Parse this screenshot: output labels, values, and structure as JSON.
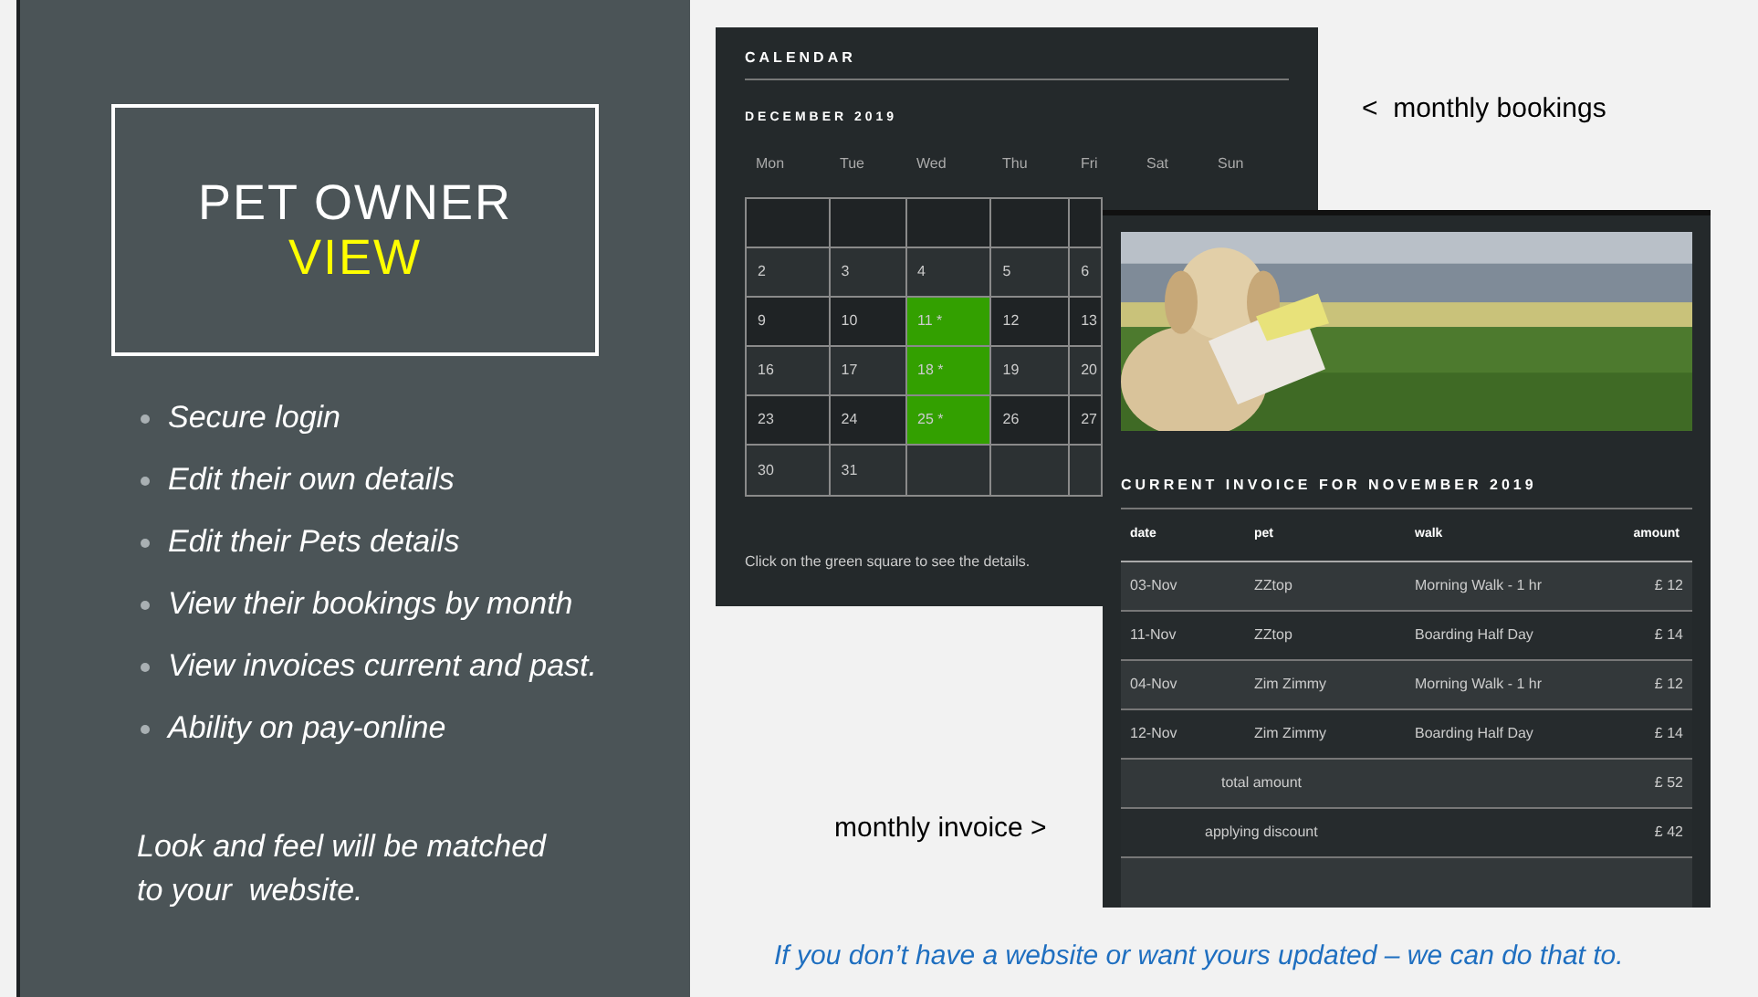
{
  "slide": {
    "title": "PET OWNER",
    "title_highlight": "VIEW",
    "bullets": [
      "Secure login",
      "Edit their own details",
      "Edit their Pets details",
      "View their bookings by month",
      "View invoices current and past.",
      "Ability on pay-online"
    ],
    "note": "Look and feel will be matched\nto your  website.",
    "bookings_caption": "<  monthly bookings",
    "invoice_caption": "monthly invoice >",
    "footer": "If you don’t have a website or want yours updated – we can do that to."
  },
  "calendar": {
    "title": "CALENDAR",
    "month": "DECEMBER 2019",
    "weekdays": [
      "Mon",
      "Tue",
      "Wed",
      "Thu",
      "Fri",
      "Sat",
      "Sun"
    ],
    "weeks": [
      [
        {
          "booked": false
        },
        {
          "booked": false
        },
        {
          "booked": false
        },
        {
          "booked": false
        },
        {
          "booked": false
        }
      ],
      [
        {
          "day": "2",
          "booked": false
        },
        {
          "day": "3",
          "booked": false
        },
        {
          "day": "4",
          "booked": false
        },
        {
          "day": "5",
          "booked": false
        },
        {
          "day": "6",
          "booked": false
        }
      ],
      [
        {
          "day": "9",
          "booked": false
        },
        {
          "day": "10",
          "booked": false
        },
        {
          "day": "11 *",
          "booked": true
        },
        {
          "day": "12",
          "booked": false
        },
        {
          "day": "13",
          "booked": false
        }
      ],
      [
        {
          "day": "16",
          "booked": false
        },
        {
          "day": "17",
          "booked": false
        },
        {
          "day": "18 *",
          "booked": true
        },
        {
          "day": "19",
          "booked": false
        },
        {
          "day": "20",
          "booked": false
        }
      ],
      [
        {
          "day": "23",
          "booked": false
        },
        {
          "day": "24",
          "booked": false
        },
        {
          "day": "25 *",
          "booked": true
        },
        {
          "day": "26",
          "booked": false
        },
        {
          "day": "27",
          "booked": false
        }
      ],
      [
        {
          "day": "30",
          "booked": false
        },
        {
          "day": "31",
          "booked": false
        },
        {
          "booked": false
        },
        {
          "booked": false
        },
        {
          "booked": false
        }
      ]
    ],
    "hint": "Click on the green square to see the details."
  },
  "invoice": {
    "picture": {
      "kind": "picture"
    },
    "title": "CURRENT INVOICE FOR NOVEMBER 2019",
    "columns": [
      "date",
      "pet",
      "walk",
      "amount"
    ],
    "rows": [
      {
        "date": "03-Nov",
        "pet": "ZZtop",
        "walk": "Morning Walk - 1 hr",
        "amount": "£ 12"
      },
      {
        "date": "11-Nov",
        "pet": "ZZtop",
        "walk": "Boarding Half Day",
        "amount": "£ 14"
      },
      {
        "date": "04-Nov",
        "pet": "Zim Zimmy",
        "walk": "Morning Walk - 1 hr",
        "amount": "£ 12"
      },
      {
        "date": "12-Nov",
        "pet": "Zim Zimmy",
        "walk": "Boarding Half Day",
        "amount": "£ 14"
      }
    ],
    "totals": [
      {
        "label": "total amount",
        "amount": "£ 52"
      },
      {
        "label": "applying discount",
        "amount": "£ 42"
      }
    ]
  }
}
